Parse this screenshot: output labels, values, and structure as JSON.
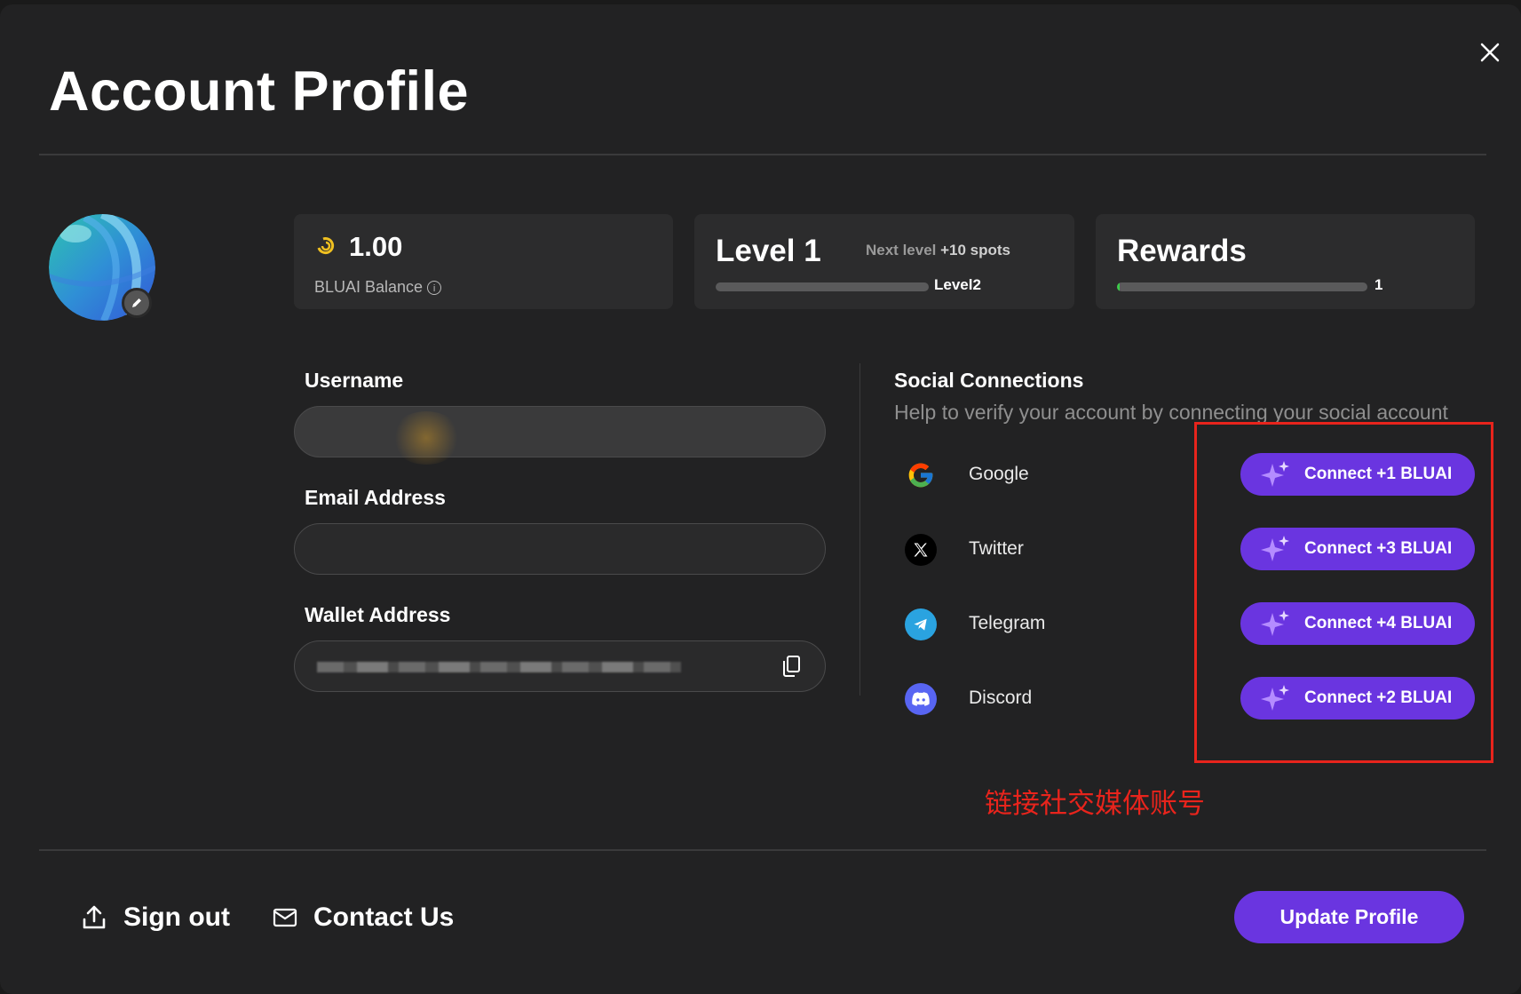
{
  "modal": {
    "title": "Account Profile"
  },
  "balance": {
    "value": "1.00",
    "label": "BLUAI Balance",
    "info": "i"
  },
  "level": {
    "title": "Level 1",
    "next_prefix": "Next level ",
    "next_value": "+10 spots",
    "progress": 0.0,
    "next_label": "Level2"
  },
  "rewards": {
    "title": "Rewards",
    "progress": 0.01,
    "count": "1"
  },
  "form": {
    "username_label": "Username",
    "email_label": "Email Address",
    "wallet_label": "Wallet Address"
  },
  "social": {
    "title": "Social Connections",
    "subtitle": "Help to verify your account by connecting your social account",
    "items": [
      {
        "name": "Google",
        "button": "Connect +1 BLUAI",
        "icon": "google-icon"
      },
      {
        "name": "Twitter",
        "button": "Connect +3 BLUAI",
        "icon": "x-twitter-icon"
      },
      {
        "name": "Telegram",
        "button": "Connect +4 BLUAI",
        "icon": "telegram-icon"
      },
      {
        "name": "Discord",
        "button": "Connect +2 BLUAI",
        "icon": "discord-icon"
      }
    ]
  },
  "annotation": "链接社交媒体账号",
  "footer": {
    "sign_out": "Sign out",
    "contact": "Contact Us",
    "update": "Update Profile"
  },
  "colors": {
    "accent": "#6a35e0",
    "annotation": "#e8241c",
    "progress": "#3ccc4a",
    "background": "#222223"
  }
}
